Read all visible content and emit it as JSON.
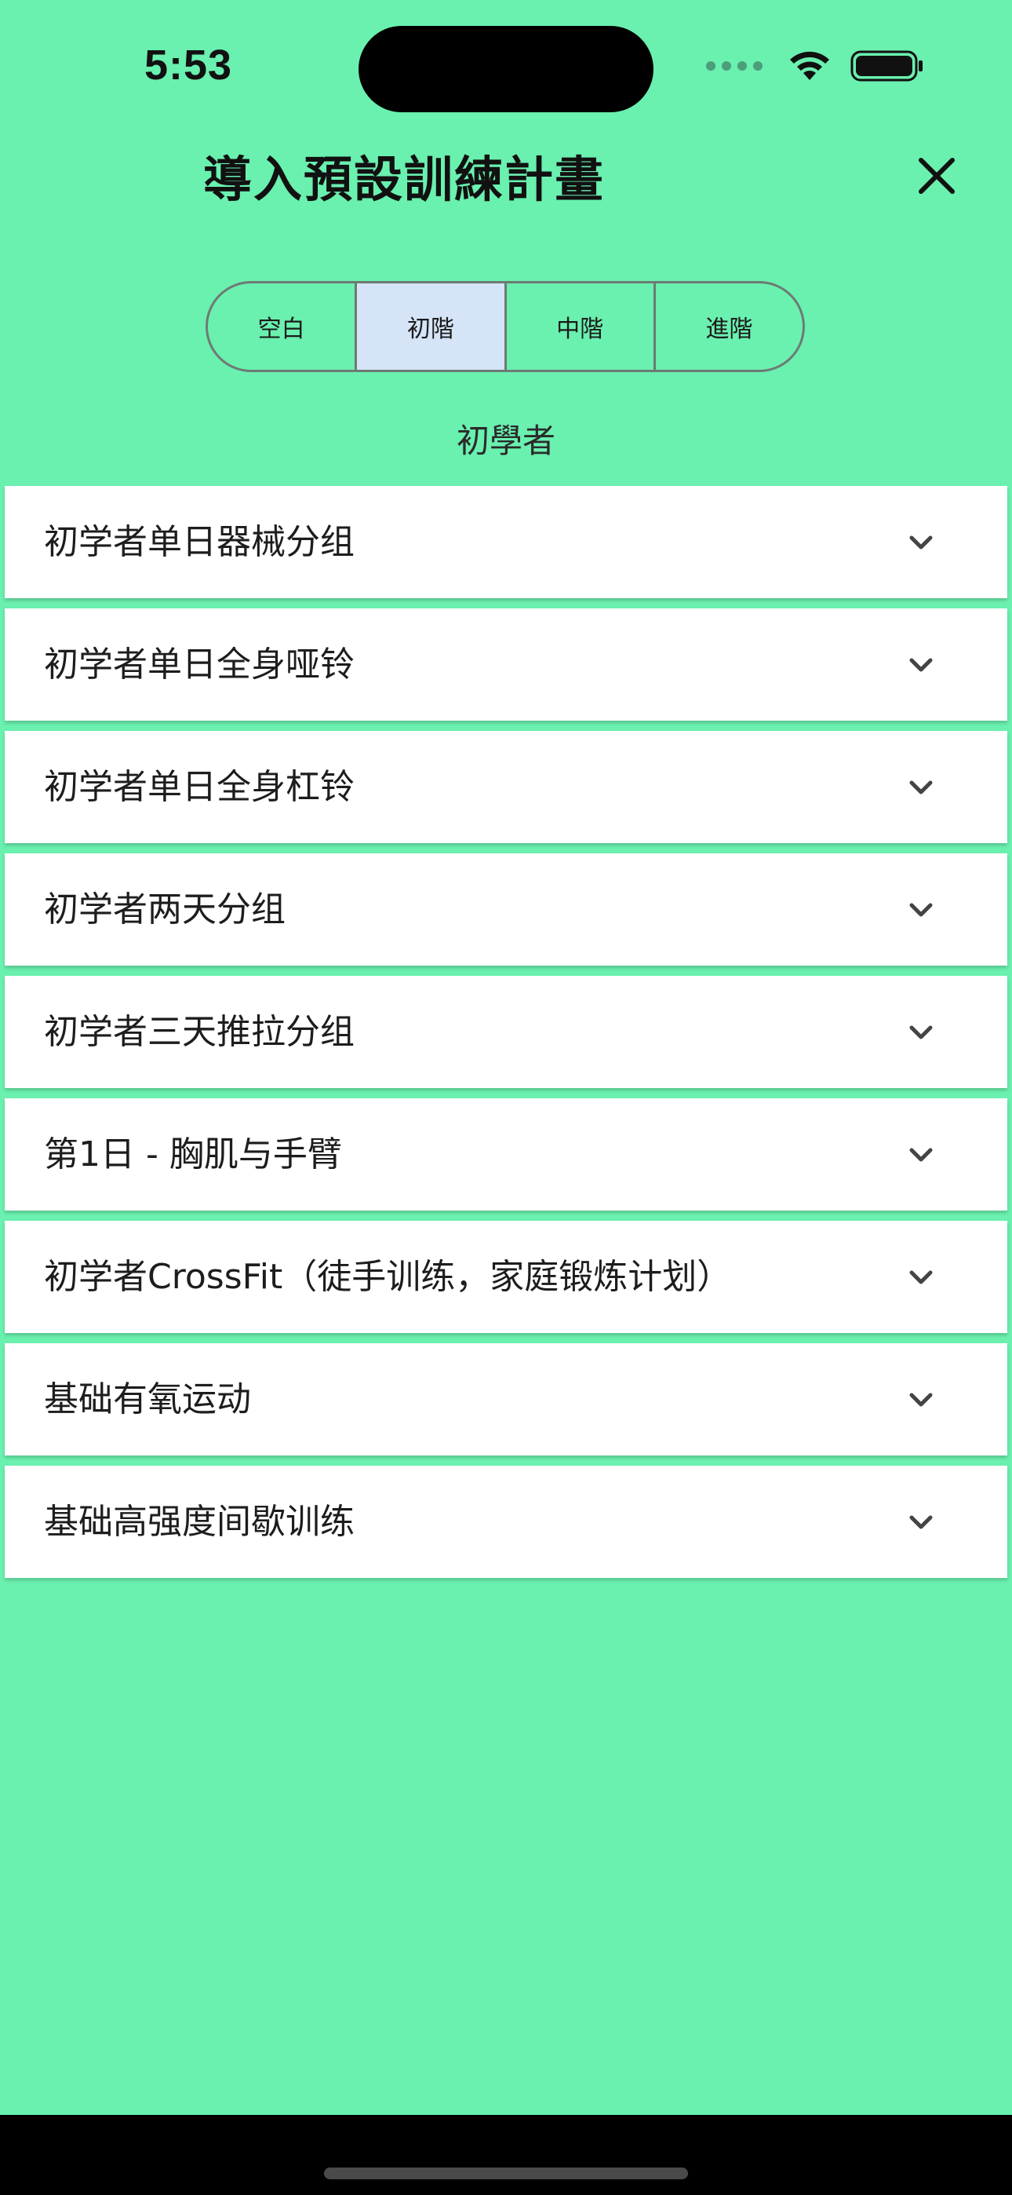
{
  "status_bar": {
    "time": "5:53",
    "icons": [
      "signal-dots-icon",
      "wifi-icon",
      "battery-icon"
    ]
  },
  "header": {
    "title": "導入預設訓練計畫",
    "close_icon": "close-icon"
  },
  "level_tabs": [
    {
      "label": "空白",
      "selected": false
    },
    {
      "label": "初階",
      "selected": true
    },
    {
      "label": "中階",
      "selected": false
    },
    {
      "label": "進階",
      "selected": false
    }
  ],
  "level_label": "初學者",
  "plans": [
    {
      "label": "初学者单日器械分组"
    },
    {
      "label": "初学者单日全身哑铃"
    },
    {
      "label": "初学者单日全身杠铃"
    },
    {
      "label": "初学者两天分组"
    },
    {
      "label": "初学者三天推拉分组"
    },
    {
      "label": "第1日 - 胸肌与手臂"
    },
    {
      "label": "初学者CrossFit（徒手训练，家庭锻炼计划）"
    },
    {
      "label": "基础有氧运动"
    },
    {
      "label": "基础高强度间歇训练"
    }
  ],
  "colors": {
    "background": "#6af0af",
    "selected_tab": "#d6e4f7",
    "card": "#ffffff"
  }
}
